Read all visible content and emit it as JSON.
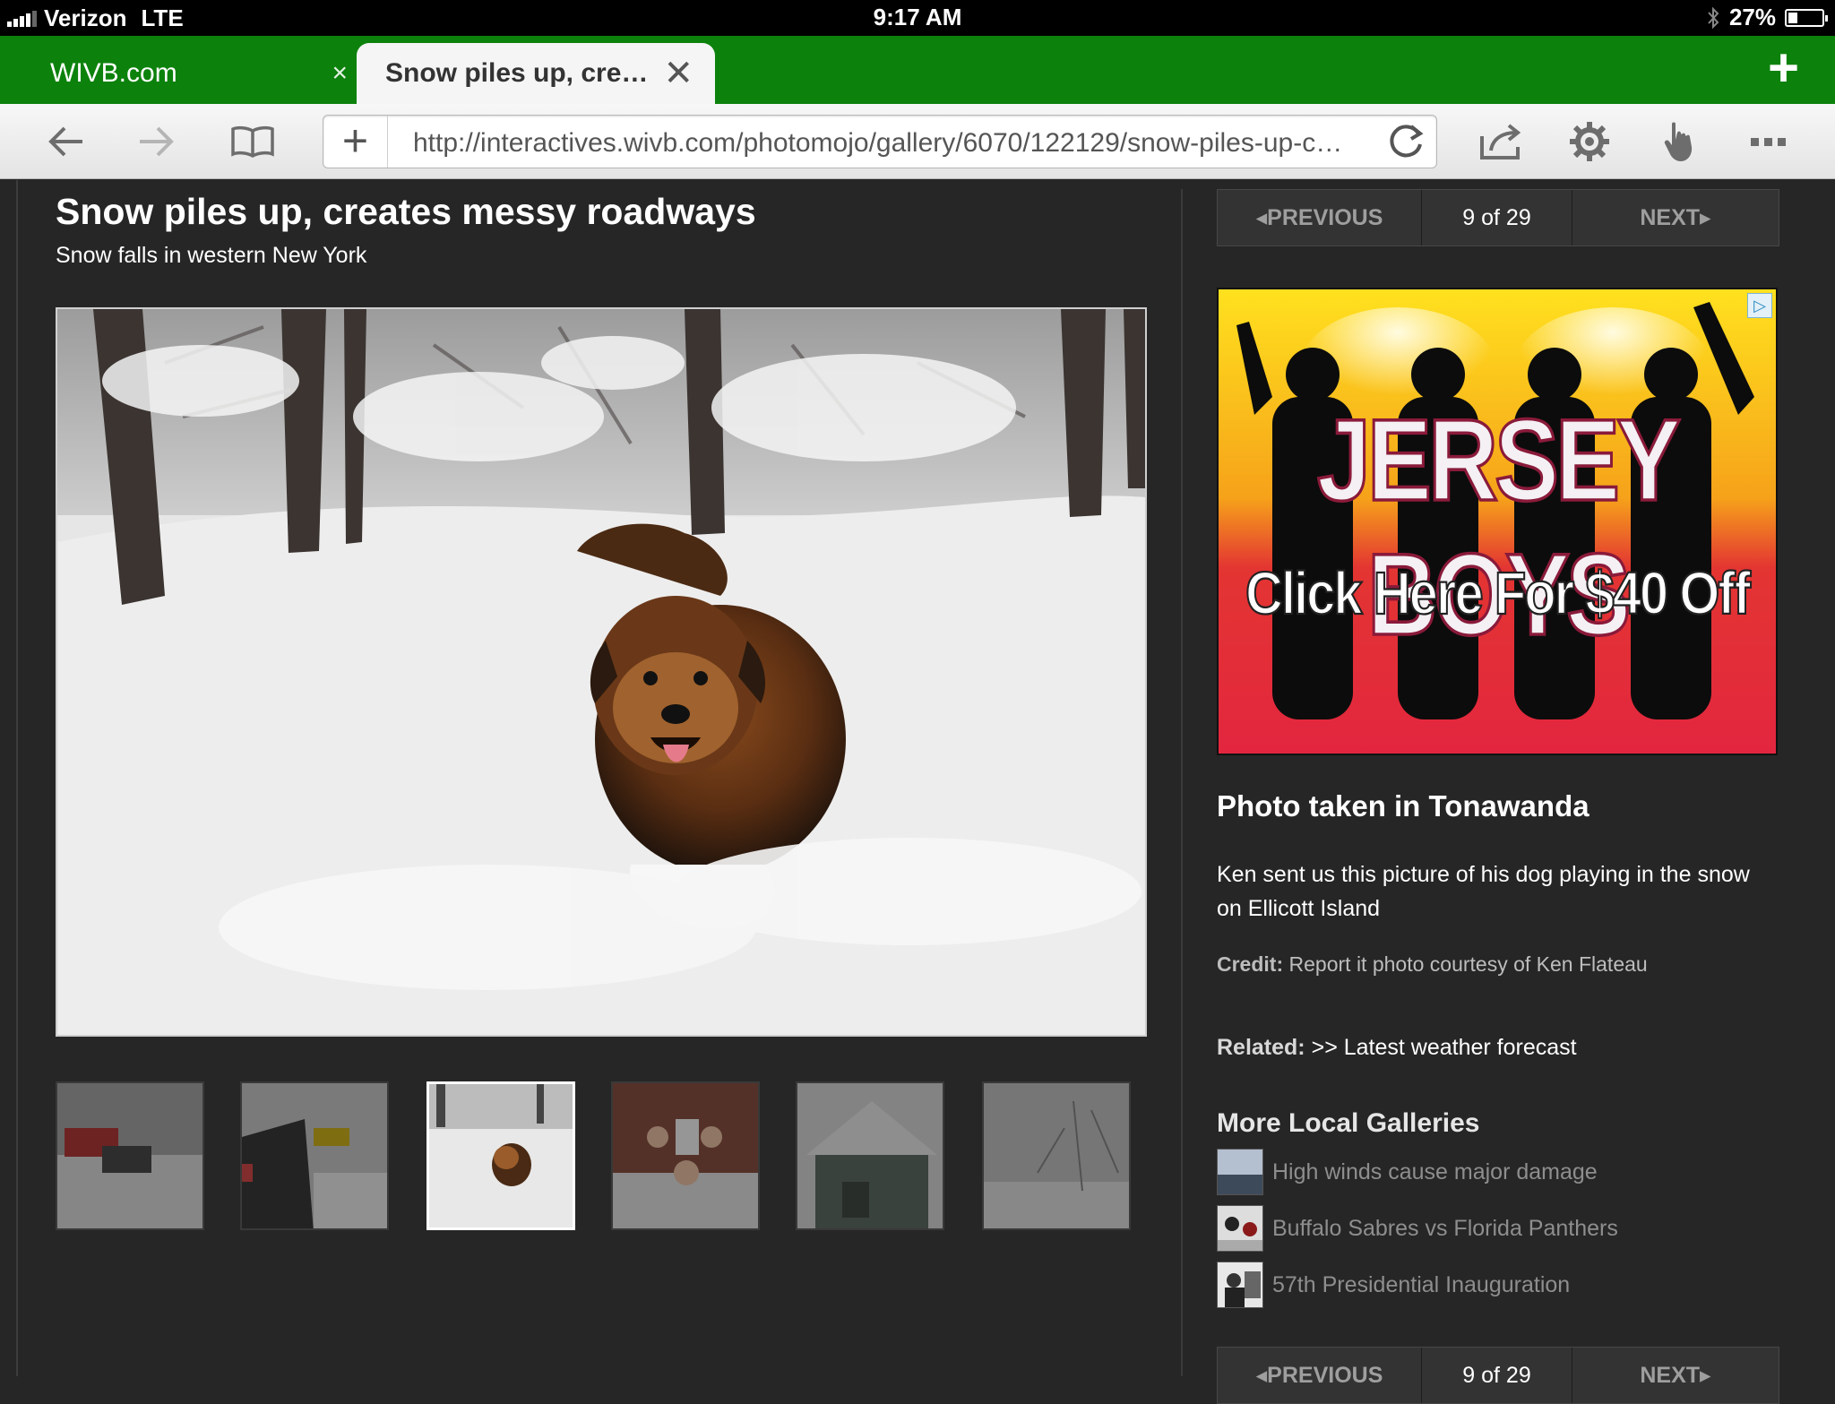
{
  "status_bar": {
    "carrier": "Verizon",
    "network": "LTE",
    "time": "9:17 AM",
    "battery": "27%",
    "battery_level": 0.27
  },
  "tabs": [
    {
      "label": "WIVB.com",
      "close": "×"
    },
    {
      "label": "Snow piles up, cre…",
      "close": "✕"
    }
  ],
  "toolbar": {
    "url": "http://interactives.wivb.com/photomojo/gallery/6070/122129/snow-piles-up-cr…",
    "new_tab": "+",
    "add": "+"
  },
  "page": {
    "title": "Snow piles up, creates messy roadways",
    "subtitle": "Snow falls in western New York"
  },
  "pager": {
    "prev": "◂PREVIOUS",
    "count": "9 of 29",
    "next": "NEXT▸"
  },
  "ad": {
    "headline": "JERSEY BOYS",
    "offer": "Click Here For $40 Off",
    "choices_icon": "▷"
  },
  "photo": {
    "title": "Photo taken in Tonawanda",
    "caption": "Ken sent us this picture of his dog playing in the snow on Ellicott Island",
    "credit_label": "Credit:",
    "credit_text": "Report it photo courtesy of Ken Flateau",
    "related_label": "Related:",
    "related_text": ">> Latest weather forecast"
  },
  "more_galleries": {
    "title": "More Local Galleries",
    "items": [
      {
        "label": "High winds cause major damage"
      },
      {
        "label": "Buffalo Sabres vs Florida Panthers"
      },
      {
        "label": "57th Presidential Inauguration"
      }
    ]
  },
  "bottom_pager": {
    "prev": "◂PREVIOUS",
    "count": "9 of 29",
    "next": "NEXT▸"
  },
  "colors": {
    "tab_green": "#0c820c",
    "page_bg": "#262626"
  }
}
